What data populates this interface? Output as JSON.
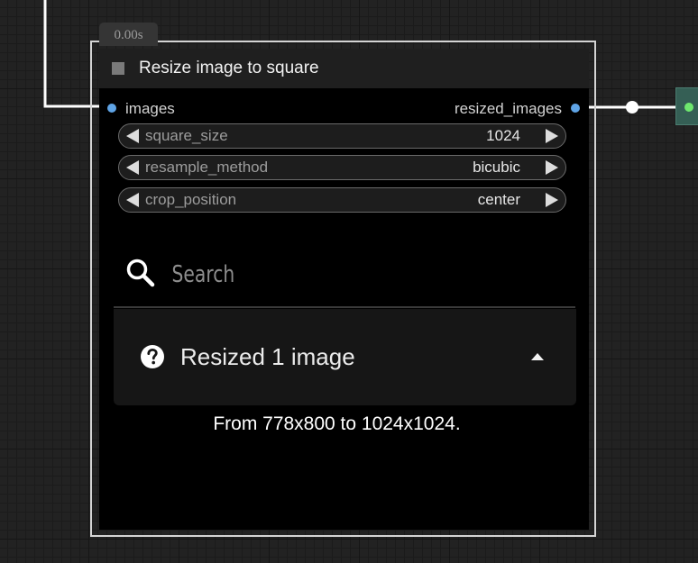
{
  "colors": {
    "canvas_background": "#222222",
    "node_body": "#000000",
    "node_title_bar": "#1f1f1f",
    "input_slot_dot": "#5fa4e6",
    "output_slot_dot": "#5fa4e6",
    "link_wire": "#ffffff",
    "next_node": "#355f55",
    "next_node_slot": "#6ee86e"
  },
  "node": {
    "execution_time": "0.00s",
    "title": "Resize image to square",
    "inputs": [
      {
        "label": "images"
      }
    ],
    "outputs": [
      {
        "label": "resized_images"
      }
    ],
    "widgets": [
      {
        "name": "square_size",
        "value": "1024"
      },
      {
        "name": "resample_method",
        "value": "bicubic"
      },
      {
        "name": "crop_position",
        "value": "center"
      }
    ],
    "search": {
      "icon": "search-icon",
      "placeholder": "Search",
      "value": ""
    },
    "message": {
      "icon": "help-circle-icon",
      "title": "Resized 1 image",
      "expanded": true,
      "body": "From 778x800 to 1024x1024."
    }
  }
}
